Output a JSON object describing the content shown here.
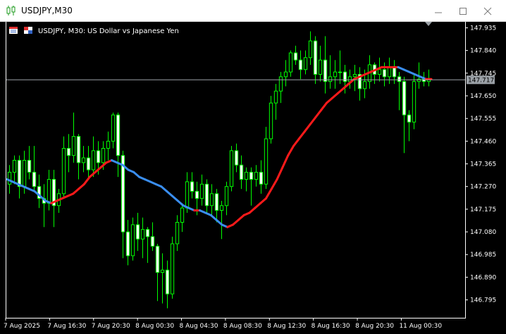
{
  "window": {
    "title": "USDJPY,M30",
    "buttons": [
      "minimize",
      "maximize",
      "close"
    ]
  },
  "chart_header": {
    "symbol_text": "USDJPY, M30:",
    "description": "US Dollar vs Japanese Yen"
  },
  "colors": {
    "bull_candle": "#00ff00",
    "bear_candle": "#00ff00",
    "ma_up": "#ff1a1a",
    "ma_down": "#3a8ef0",
    "price_line": "#9aa0a6",
    "axis": "#ffffff",
    "background": "#000000"
  },
  "chart_data": {
    "type": "candlestick",
    "symbol": "USDJPY",
    "timeframe": "M30",
    "ylim": [
      146.72,
      147.96
    ],
    "y_ticks": [
      "147.935",
      "147.840",
      "147.745",
      "147.650",
      "147.555",
      "147.460",
      "147.365",
      "147.270",
      "147.175",
      "147.080",
      "146.985",
      "146.890",
      "146.795"
    ],
    "x_ticks": [
      "7 Aug 2025",
      "7 Aug 16:30",
      "7 Aug 20:30",
      "8 Aug 00:30",
      "8 Aug 04:30",
      "8 Aug 08:30",
      "8 Aug 12:30",
      "8 Aug 16:30",
      "8 Aug 20:30",
      "11 Aug 00:30"
    ],
    "current_price": "147.717",
    "candles": [
      [
        147.28,
        147.36,
        147.24,
        147.33
      ],
      [
        147.33,
        147.4,
        147.28,
        147.38
      ],
      [
        147.38,
        147.4,
        147.22,
        147.27
      ],
      [
        147.27,
        147.42,
        147.24,
        147.38
      ],
      [
        147.38,
        147.44,
        147.3,
        147.33
      ],
      [
        147.33,
        147.44,
        147.25,
        147.27
      ],
      [
        147.27,
        147.32,
        147.18,
        147.22
      ],
      [
        147.22,
        147.28,
        147.1,
        147.2
      ],
      [
        147.2,
        147.34,
        147.17,
        147.3
      ],
      [
        147.3,
        147.34,
        147.1,
        147.19
      ],
      [
        147.19,
        147.26,
        147.16,
        147.24
      ],
      [
        147.24,
        147.48,
        147.22,
        147.43
      ],
      [
        147.43,
        147.49,
        147.33,
        147.4
      ],
      [
        147.4,
        147.58,
        147.37,
        147.48
      ],
      [
        147.48,
        147.49,
        147.3,
        147.37
      ],
      [
        147.37,
        147.44,
        147.33,
        147.39
      ],
      [
        147.39,
        147.44,
        147.3,
        147.34
      ],
      [
        147.34,
        147.48,
        147.31,
        147.42
      ],
      [
        147.42,
        147.46,
        147.32,
        147.37
      ],
      [
        147.37,
        147.46,
        147.34,
        147.43
      ],
      [
        147.43,
        147.5,
        147.38,
        147.46
      ],
      [
        147.46,
        147.58,
        147.43,
        147.57
      ],
      [
        147.57,
        147.58,
        147.31,
        147.4
      ],
      [
        147.4,
        147.42,
        146.97,
        147.08
      ],
      [
        147.08,
        147.13,
        146.94,
        146.98
      ],
      [
        146.98,
        147.14,
        146.96,
        147.11
      ],
      [
        147.11,
        147.16,
        147.0,
        147.05
      ],
      [
        147.05,
        147.14,
        146.97,
        147.09
      ],
      [
        147.09,
        147.1,
        146.95,
        147.06
      ],
      [
        147.06,
        147.12,
        147.0,
        147.02
      ],
      [
        147.02,
        147.03,
        146.79,
        146.91
      ],
      [
        146.91,
        146.99,
        146.78,
        146.92
      ],
      [
        146.92,
        146.96,
        146.76,
        146.82
      ],
      [
        146.82,
        147.06,
        146.8,
        147.03
      ],
      [
        147.03,
        147.15,
        147.0,
        147.12
      ],
      [
        147.12,
        147.2,
        147.08,
        147.18
      ],
      [
        147.18,
        147.33,
        147.16,
        147.29
      ],
      [
        147.29,
        147.33,
        147.22,
        147.25
      ],
      [
        147.25,
        147.29,
        147.15,
        147.22
      ],
      [
        147.22,
        147.32,
        147.19,
        147.28
      ],
      [
        147.28,
        147.3,
        147.16,
        147.19
      ],
      [
        147.19,
        147.28,
        147.15,
        147.24
      ],
      [
        147.24,
        147.26,
        147.12,
        147.17
      ],
      [
        147.17,
        147.21,
        147.05,
        147.19
      ],
      [
        147.19,
        147.29,
        147.15,
        147.27
      ],
      [
        147.27,
        147.44,
        147.25,
        147.42
      ],
      [
        147.42,
        147.45,
        147.33,
        147.36
      ],
      [
        147.36,
        147.4,
        147.26,
        147.3
      ],
      [
        147.3,
        147.35,
        147.25,
        147.33
      ],
      [
        147.33,
        147.35,
        147.19,
        147.3
      ],
      [
        147.3,
        147.36,
        147.27,
        147.33
      ],
      [
        147.33,
        147.38,
        147.24,
        147.28
      ],
      [
        147.28,
        147.52,
        147.26,
        147.47
      ],
      [
        147.47,
        147.65,
        147.45,
        147.62
      ],
      [
        147.62,
        147.7,
        147.55,
        147.67
      ],
      [
        147.67,
        147.75,
        147.62,
        147.73
      ],
      [
        147.73,
        147.8,
        147.69,
        147.75
      ],
      [
        147.75,
        147.84,
        147.73,
        147.83
      ],
      [
        147.83,
        147.86,
        147.78,
        147.8
      ],
      [
        147.8,
        147.84,
        147.72,
        147.76
      ],
      [
        147.76,
        147.84,
        147.74,
        147.81
      ],
      [
        147.81,
        147.92,
        147.78,
        147.88
      ],
      [
        147.88,
        147.9,
        147.7,
        147.74
      ],
      [
        147.74,
        147.86,
        147.71,
        147.8
      ],
      [
        147.8,
        147.9,
        147.66,
        147.71
      ],
      [
        147.71,
        147.82,
        147.68,
        147.73
      ],
      [
        147.73,
        147.8,
        147.68,
        147.75
      ],
      [
        147.75,
        147.84,
        147.7,
        147.75
      ],
      [
        147.75,
        147.78,
        147.66,
        147.71
      ],
      [
        147.71,
        147.76,
        147.68,
        147.73
      ],
      [
        147.73,
        147.78,
        147.67,
        147.74
      ],
      [
        147.74,
        147.77,
        147.63,
        147.68
      ],
      [
        147.68,
        147.76,
        147.64,
        147.71
      ],
      [
        147.71,
        147.82,
        147.68,
        147.78
      ],
      [
        147.78,
        147.79,
        147.7,
        147.74
      ],
      [
        147.74,
        147.81,
        147.71,
        147.76
      ],
      [
        147.76,
        147.79,
        147.69,
        147.73
      ],
      [
        147.73,
        147.81,
        147.7,
        147.77
      ],
      [
        147.77,
        147.8,
        147.7,
        147.73
      ],
      [
        147.73,
        147.75,
        147.59,
        147.71
      ],
      [
        147.71,
        147.73,
        147.41,
        147.57
      ],
      [
        147.57,
        147.59,
        147.46,
        147.54
      ],
      [
        147.54,
        147.74,
        147.51,
        147.71
      ],
      [
        147.71,
        147.79,
        147.68,
        147.72
      ],
      [
        147.72,
        147.75,
        147.69,
        147.71
      ],
      [
        147.71,
        147.76,
        147.69,
        147.72
      ]
    ],
    "moving_average": [
      147.3,
      147.29,
      147.28,
      147.27,
      147.26,
      147.25,
      147.23,
      147.21,
      147.2,
      147.21,
      147.22,
      147.23,
      147.24,
      147.26,
      147.28,
      147.31,
      147.33,
      147.35,
      147.37,
      147.38,
      147.37,
      147.36,
      147.34,
      147.33,
      147.31,
      147.3,
      147.29,
      147.28,
      147.27,
      147.25,
      147.23,
      147.21,
      147.19,
      147.18,
      147.17,
      147.17,
      147.16,
      147.15,
      147.13,
      147.11,
      147.1,
      147.11,
      147.13,
      147.15,
      147.16,
      147.18,
      147.2,
      147.22,
      147.26,
      147.3,
      147.35,
      147.4,
      147.44,
      147.47,
      147.5,
      147.53,
      147.56,
      147.59,
      147.62,
      147.64,
      147.66,
      147.68,
      147.7,
      147.72,
      147.73,
      147.74,
      147.75,
      147.76,
      147.77,
      147.77,
      147.77,
      147.77,
      147.76,
      147.75,
      147.74,
      147.73,
      147.72,
      147.72
    ]
  }
}
